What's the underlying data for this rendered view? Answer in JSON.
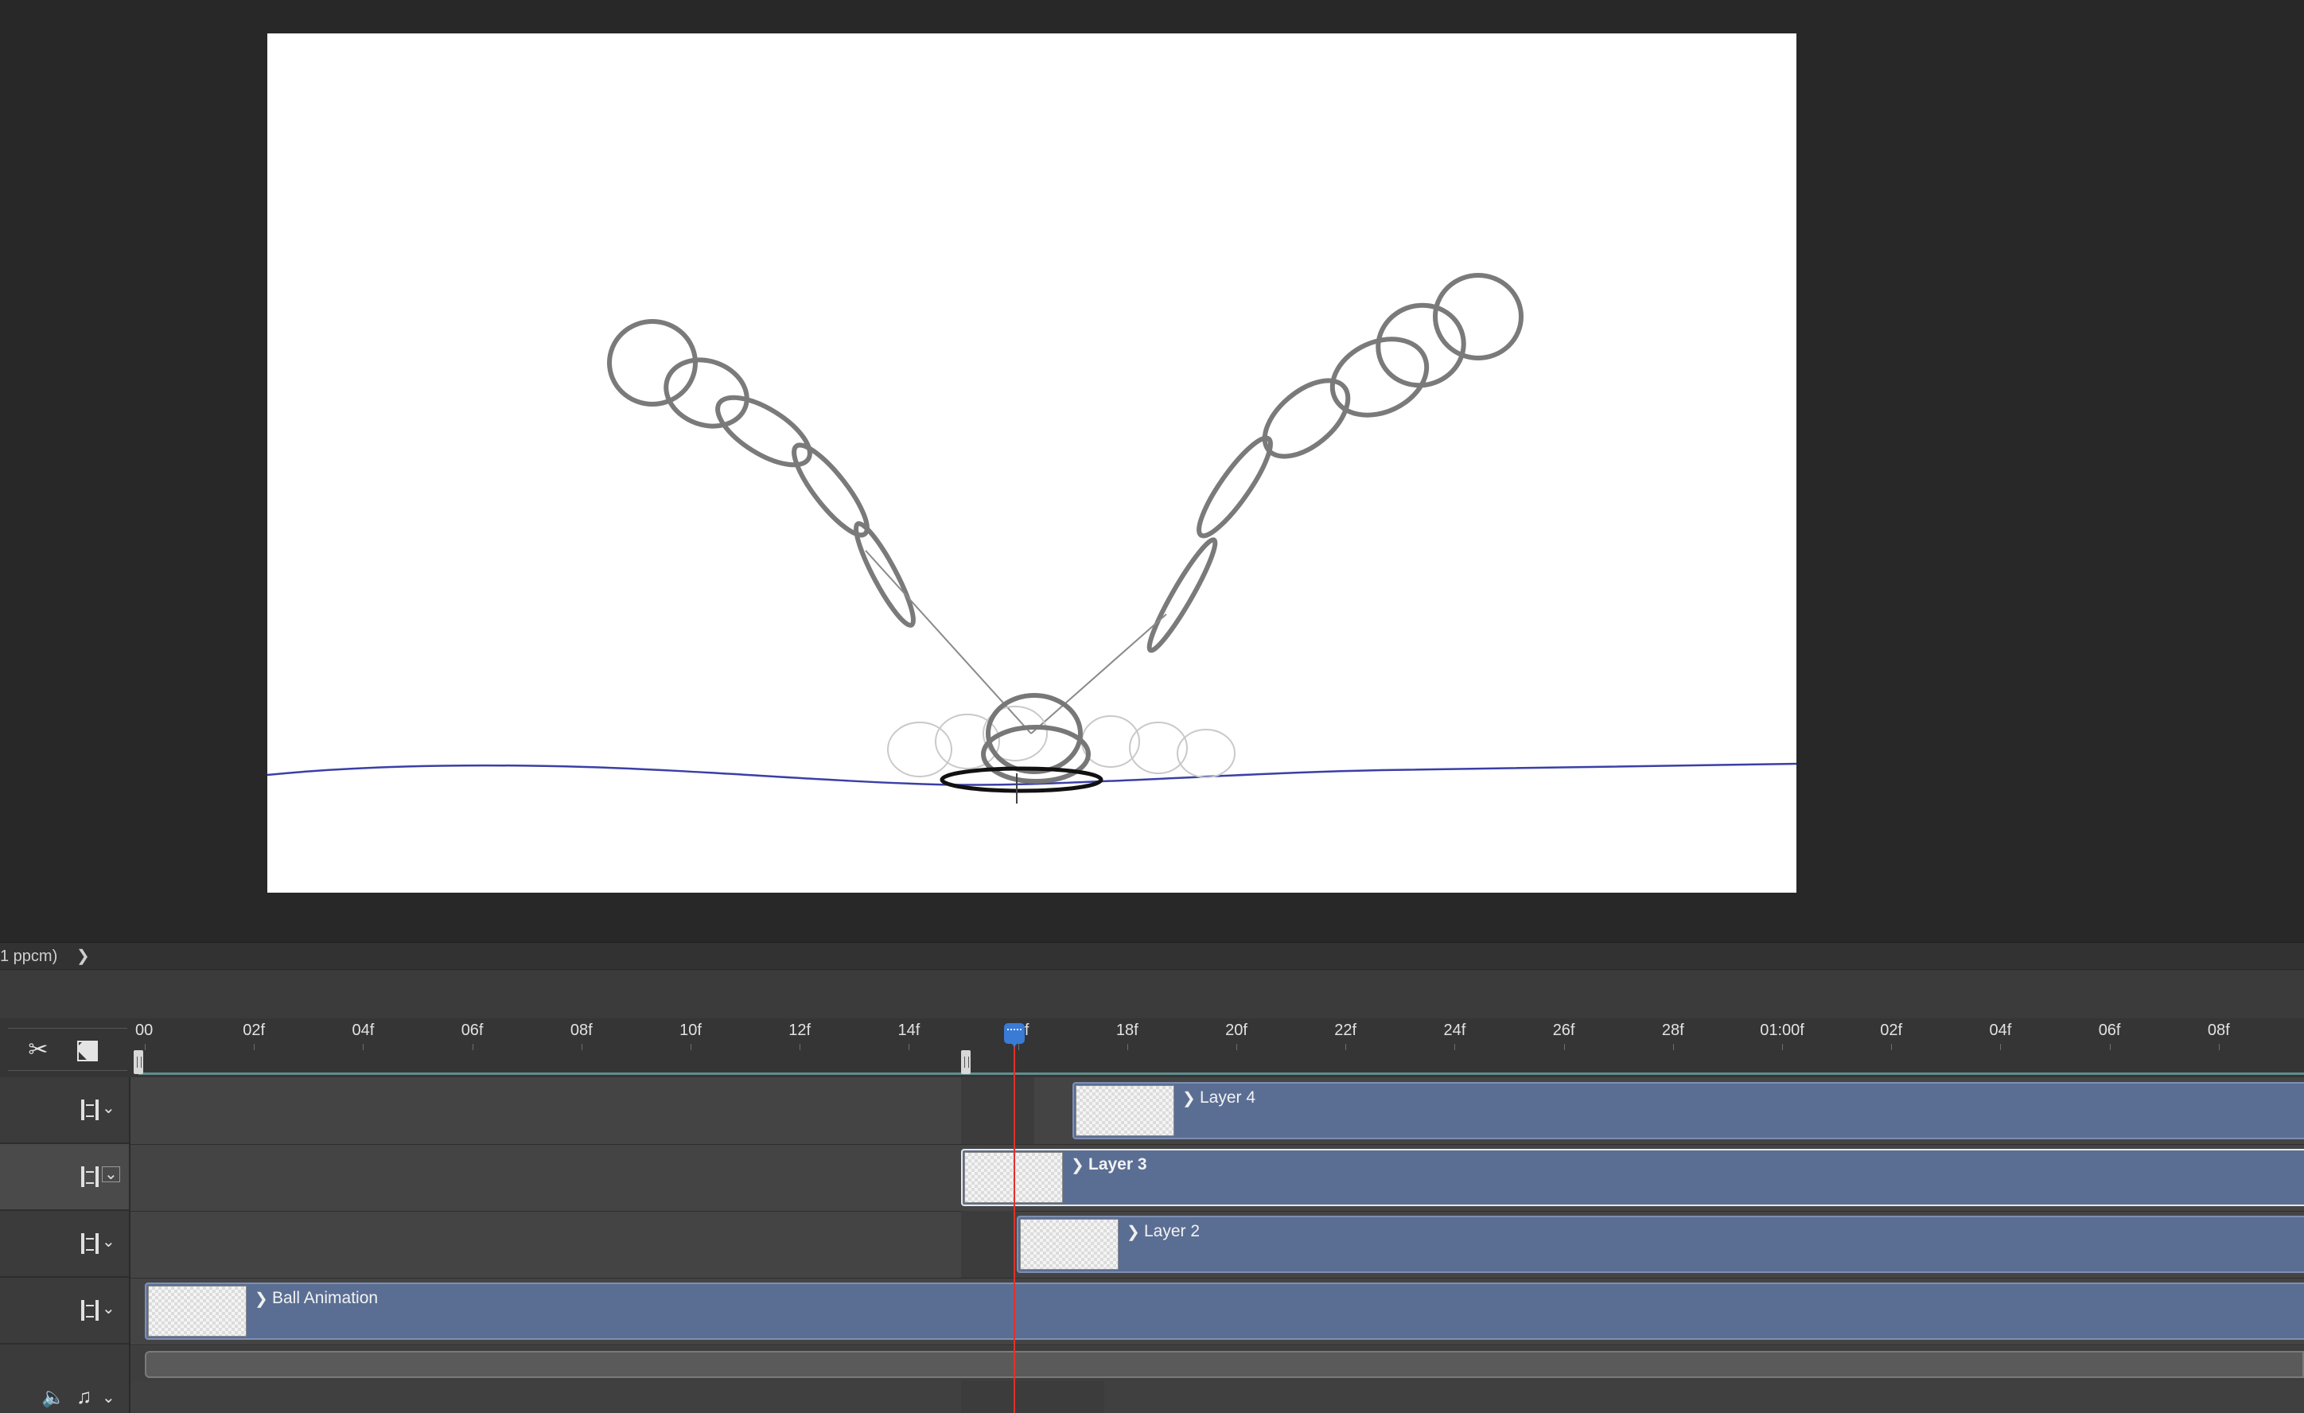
{
  "status_bar": {
    "doc_info": "1 ppcm)",
    "more_arrow": "❯"
  },
  "timeline": {
    "tools": {
      "split_icon": "scissors-icon",
      "transition_icon": "transition-icon"
    },
    "ruler_labels": [
      "00",
      "02f",
      "04f",
      "06f",
      "08f",
      "10f",
      "12f",
      "14f",
      "16f",
      "18f",
      "20f",
      "22f",
      "24f",
      "26f",
      "28f",
      "01:00f",
      "02f",
      "04f",
      "06f",
      "08f"
    ],
    "playhead_frame": "16f",
    "tracks": [
      {
        "clip_label": "Layer 4",
        "selected": false
      },
      {
        "clip_label": "Layer 3",
        "selected": true
      },
      {
        "clip_label": "Layer 2",
        "selected": false
      },
      {
        "clip_label": "Ball Animation",
        "selected": false
      }
    ],
    "chevron": "❯",
    "dropdown": "⌄"
  },
  "colors": {
    "clip": "#5a6e94",
    "playhead": "#e0322a",
    "playhead_head": "#3a7bd5",
    "work_area": "#5f8e8d",
    "ground_line": "#3b3fa6"
  }
}
